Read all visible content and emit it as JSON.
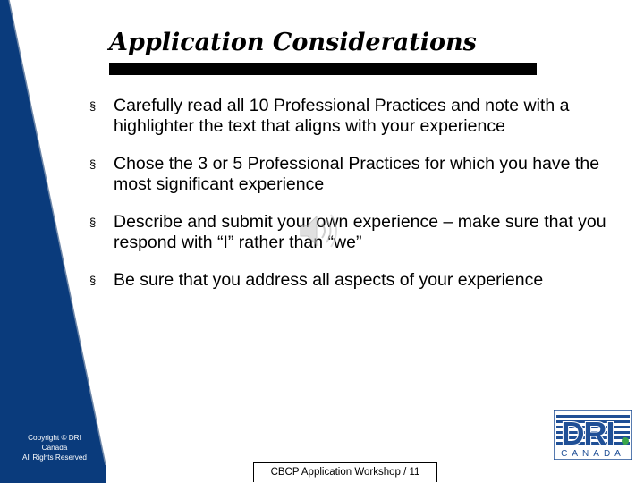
{
  "title": "Application Considerations",
  "bullets": [
    {
      "text": "Carefully read all 10 Professional Practices and note with a highlighter the text that aligns with your experience"
    },
    {
      "text": "Chose the 3 or 5 Professional Practices for which you have the most significant experience"
    },
    {
      "text": "Describe and submit your own experience – make sure that you respond with “I” rather than “we”"
    },
    {
      "text": "Be sure that you address all aspects of your experience"
    }
  ],
  "bullet_marker": "§",
  "copyright": [
    "Copyright © DRI",
    "Canada",
    "All Rights Reserved"
  ],
  "footer": "CBCP Application Workshop / 11",
  "logo": {
    "brand": "DRI",
    "sub": "CANADA"
  },
  "icons": [
    "speaker-icon"
  ],
  "colors": {
    "sidebar": "#0a3b7c",
    "logo_blue": "#1f4f96",
    "logo_green": "#3aa64a"
  }
}
